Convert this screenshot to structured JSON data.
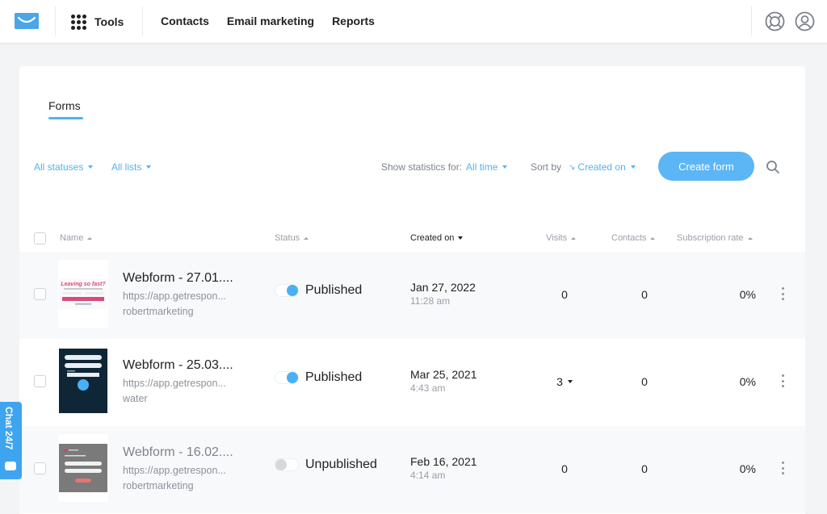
{
  "topbar": {
    "logo_icon": "getresponse-envelope-logo",
    "tools_label": "Tools",
    "nav": [
      "Contacts",
      "Email marketing",
      "Reports"
    ],
    "help_icon": "lifebuoy-icon",
    "account_icon": "user-circle-icon"
  },
  "page": {
    "tab": "Forms",
    "filters": {
      "status": "All statuses",
      "lists": "All lists",
      "stats_label": "Show statistics for:",
      "stats_value": "All time",
      "sort_label": "Sort by",
      "sort_value": "Created on"
    },
    "create_button": "Create form",
    "accent": "#4db4f3"
  },
  "table": {
    "columns": [
      "Name",
      "Status",
      "Created on",
      "Visits",
      "Contacts",
      "Subscription rate"
    ],
    "rows": [
      {
        "name": "Webform - 27.01....",
        "url": "https://app.getrespon...",
        "list": "robertmarketing",
        "status": "Published",
        "published": true,
        "date": "Jan 27, 2022",
        "time": "11:28 am",
        "visits": "0",
        "contacts": "0",
        "rate": "0%"
      },
      {
        "name": "Webform - 25.03....",
        "url": "https://app.getrespon...",
        "list": "water",
        "status": "Published",
        "published": true,
        "date": "Mar 25, 2021",
        "time": "4:43 am",
        "visits": "3",
        "contacts": "0",
        "rate": "0%"
      },
      {
        "name": "Webform - 16.02....",
        "url": "https://app.getrespon...",
        "list": "robertmarketing",
        "status": "Unpublished",
        "published": false,
        "date": "Feb 16, 2021",
        "time": "4:14 am",
        "visits": "0",
        "contacts": "0",
        "rate": "0%"
      }
    ]
  },
  "chat": {
    "label": "Chat 24/7"
  }
}
